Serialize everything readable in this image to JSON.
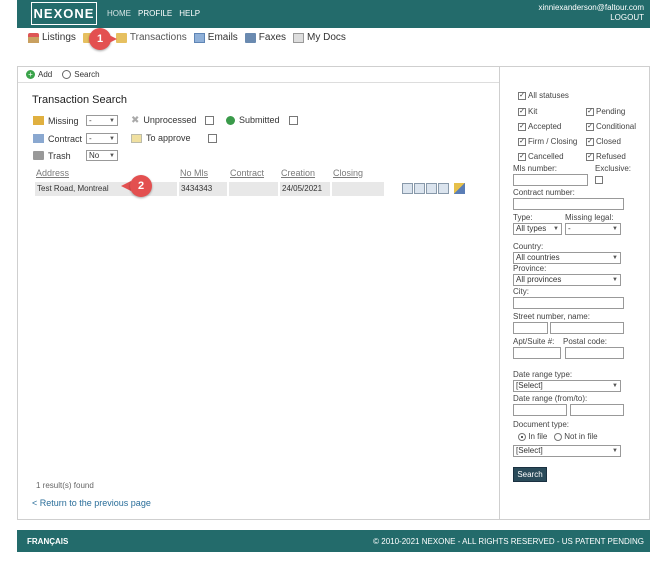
{
  "brand": {
    "logo": "NEXONE"
  },
  "topnav": [
    "HOME",
    "PROFILE",
    "HELP"
  ],
  "user": {
    "email": "xinniexanderson@faltour.com",
    "logout": "LOGOUT"
  },
  "subnav": {
    "listings": "Listings",
    "transactions": "Transactions",
    "emails": "Emails",
    "faxes": "Faxes",
    "mydocs": "My Docs"
  },
  "markers": {
    "m1": "1",
    "m2": "2"
  },
  "toolbar": {
    "add": "Add",
    "search": "Search"
  },
  "page_title": "Transaction Search",
  "filters": {
    "missing": {
      "label": "Missing",
      "value": "-"
    },
    "unprocessed": {
      "label": "Unprocessed"
    },
    "submitted": {
      "label": "Submitted"
    },
    "contract": {
      "label": "Contract",
      "value": "-"
    },
    "to_approve": {
      "label": "To approve"
    },
    "trash": {
      "label": "Trash",
      "value": "No"
    }
  },
  "table": {
    "headers": [
      "Address",
      "No Mls",
      "Contract",
      "Creation",
      "Closing"
    ],
    "rows": [
      {
        "address": "Test Road, Montreal",
        "mls": "3434343",
        "contract": "",
        "creation": "24/05/2021",
        "closing": ""
      }
    ]
  },
  "results_text": "1 result(s) found",
  "back_link": "< Return to the previous page",
  "right": {
    "all_statuses": "All statuses",
    "statuses": [
      "Kit",
      "Pending",
      "Accepted",
      "Conditional",
      "Firm / Closing",
      "Closed",
      "Cancelled",
      "Refused"
    ],
    "mls_number": "Mls number:",
    "exclusive": "Exclusive:",
    "contract_number": "Contract number:",
    "type_label": "Type:",
    "type_value": "All types",
    "missing_legal": "Missing legal:",
    "missing_legal_value": "-",
    "country_label": "Country:",
    "country_value": "All countries",
    "province_label": "Province:",
    "province_value": "All provinces",
    "city_label": "City:",
    "street_label": "Street number, name:",
    "apt_label": "Apt/Suite #:",
    "postal_label": "Postal code:",
    "date_range_type": "Date range type:",
    "date_range_type_value": "[Select]",
    "date_range": "Date range (from/to):",
    "doc_type": "Document type:",
    "in_file": "In file",
    "not_in_file": "Not in file",
    "doc_type_value": "[Select]",
    "search_btn": "Search"
  },
  "footer": {
    "lang": "FRANÇAIS",
    "copyright": "© 2010-2021 NEXONE - ALL RIGHTS RESERVED - US PATENT PENDING"
  },
  "colors": {
    "brand_teal": "#236b6b",
    "marker_red": "#e35050",
    "link_blue": "#2a6e9a"
  }
}
